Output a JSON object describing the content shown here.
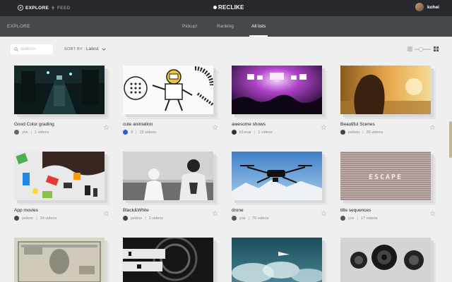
{
  "topbar": {
    "explore_label": "EXPLORE",
    "feed_label": "FEED",
    "brand": "RECLIKE",
    "username": "kohei"
  },
  "subnav": {
    "section": "EXPLORE",
    "tabs": [
      {
        "label": "Pickup!",
        "active": false
      },
      {
        "label": "Ranking",
        "active": false
      },
      {
        "label": "All lists",
        "active": true
      }
    ]
  },
  "toolbar": {
    "search_placeholder": "SEARCH",
    "sort_label": "SORT BY :",
    "sort_value": "Latest"
  },
  "cards": [
    {
      "title": "Good Color grading",
      "user": "yos",
      "count": "1 videos"
    },
    {
      "title": "cute animation",
      "user": "9",
      "count": "15 videos"
    },
    {
      "title": "awesome shows",
      "user": "b1ocar",
      "count": "1 videos"
    },
    {
      "title": "Beautiful Scenes",
      "user": "peikoo",
      "count": "26 videos"
    },
    {
      "title": "App movies",
      "user": "peikoo",
      "count": "34 videos"
    },
    {
      "title": "Black&White",
      "user": "peikoo",
      "count": "3 videos"
    },
    {
      "title": "drone",
      "user": "yos",
      "count": "70 videos"
    },
    {
      "title": "title sequences",
      "user": "yos",
      "count": "17 videos"
    },
    {
      "title": "",
      "user": "",
      "count": ""
    },
    {
      "title": "",
      "user": "",
      "count": ""
    },
    {
      "title": "",
      "user": "",
      "count": ""
    },
    {
      "title": "",
      "user": "",
      "count": ""
    }
  ],
  "thumb_text": {
    "escape": "ESCAPE"
  },
  "colors": {
    "topbar": "#26282b",
    "subnav": "#45484c",
    "background": "#efefef",
    "scrollbar": "#c2b59a"
  }
}
